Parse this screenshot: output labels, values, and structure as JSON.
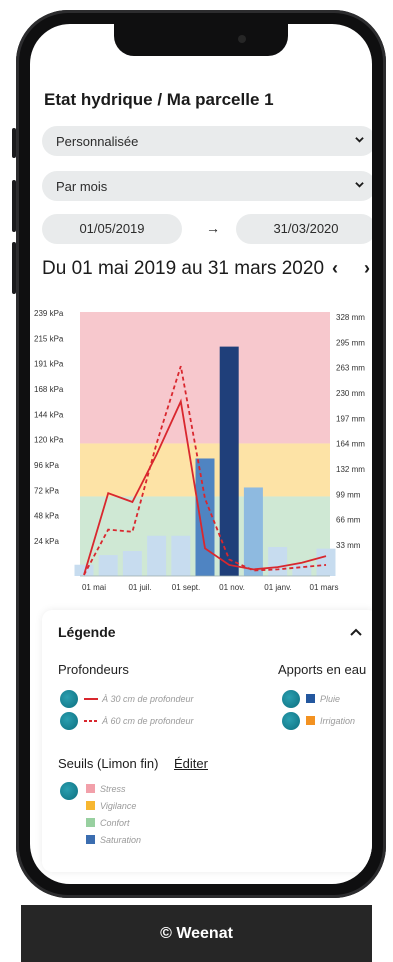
{
  "header": {
    "title": "Etat hydrique / Ma parcelle 1"
  },
  "filters": {
    "mode": "Personnalisée",
    "granularity": "Par mois",
    "start_date": "01/05/2019",
    "end_date": "31/03/2020",
    "range_label": "Du 01 mai 2019 au 31 mars 2020",
    "prev_label": "‹",
    "next_label": "›",
    "arrow": "→"
  },
  "chart_data": {
    "type": "bar",
    "categories": [
      "01 mai",
      "01 juil.",
      "01 sept.",
      "01 nov.",
      "01 janv.",
      "01 mars"
    ],
    "left_ticks": [
      "239 kPa",
      "215 kPa",
      "191 kPa",
      "168 kPa",
      "144 kPa",
      "120 kPa",
      "96 kPa",
      "72 kPa",
      "48 kPa",
      "24 kPa"
    ],
    "right_ticks": [
      "328 mm",
      "295 mm",
      "263 mm",
      "230 mm",
      "197 mm",
      "164 mm",
      "132 mm",
      "99 mm",
      "66 mm",
      "33 mm"
    ],
    "ylim_left": [
      0,
      239
    ],
    "ylim_right": [
      0,
      328
    ],
    "zones": [
      {
        "name": "Stress",
        "from": 120,
        "to": 239,
        "color": "#f7c8cd"
      },
      {
        "name": "Vigilance",
        "from": 72,
        "to": 120,
        "color": "#fde3a6"
      },
      {
        "name": "Confort",
        "from": 0,
        "to": 72,
        "color": "#cfe8d4"
      }
    ],
    "pluie_mm": [
      14,
      26,
      31,
      50,
      50,
      17,
      20,
      17,
      36,
      15,
      34
    ],
    "pluie_highlight_mm": [
      0,
      0,
      0,
      0,
      0,
      146,
      0,
      0,
      0,
      0,
      0
    ],
    "saturation_mm": [
      0,
      0,
      0,
      0,
      0,
      0,
      285,
      0,
      0,
      0,
      0
    ],
    "pluie_light_mm": [
      0,
      0,
      0,
      0,
      0,
      0,
      0,
      110,
      0,
      0,
      0
    ],
    "series": [
      {
        "name": "À 30 cm de profondeur",
        "style": "solid",
        "values": [
          1,
          75,
          67,
          110,
          158,
          25,
          10,
          6,
          8,
          12,
          18
        ]
      },
      {
        "name": "À 60 cm de profondeur",
        "style": "dashed",
        "values": [
          1,
          42,
          40,
          120,
          190,
          70,
          15,
          5,
          6,
          8,
          10
        ]
      }
    ]
  },
  "legend": {
    "title": "Légende",
    "toggle": "^",
    "depths_title": "Profondeurs",
    "depth_30": "À 30 cm de profondeur",
    "depth_60": "À 60 cm de profondeur",
    "water_title": "Apports en eau",
    "pluie": "Pluie",
    "irrigation": "Irrigation",
    "seuils_title": "Seuils (Limon fin)",
    "edit": "Éditer",
    "stress": "Stress",
    "vigilance": "Vigilance",
    "confort": "Confort",
    "saturation": "Saturation",
    "colors": {
      "depth_line": "#d9272e",
      "pluie": "#23579e",
      "irrigation": "#f39221",
      "stress": "#f2a0aa",
      "vigilance": "#f7b731",
      "confort": "#98d0a0",
      "saturation": "#3b6db0",
      "accent_dot": "#0f7d8d"
    }
  },
  "footer": {
    "copyright": "© Weenat"
  }
}
